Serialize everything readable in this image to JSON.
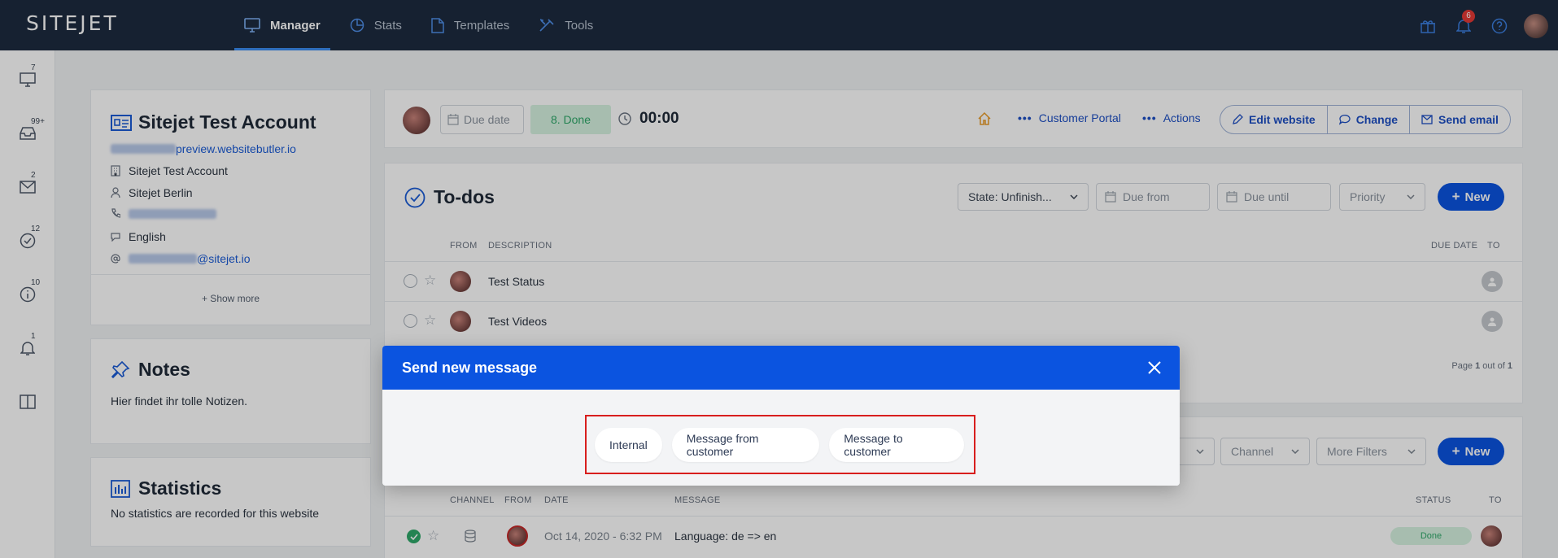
{
  "app": {
    "logo": "SITEJET"
  },
  "topnav": {
    "tabs": [
      {
        "label": "Manager",
        "icon": "monitor-icon",
        "active": true
      },
      {
        "label": "Stats",
        "icon": "pie-chart-icon"
      },
      {
        "label": "Templates",
        "icon": "document-icon"
      },
      {
        "label": "Tools",
        "icon": "tools-icon"
      }
    ],
    "notification_count": "6"
  },
  "rail": {
    "items": [
      {
        "icon": "monitor-icon",
        "count": "7"
      },
      {
        "icon": "inbox-icon",
        "count": "99+"
      },
      {
        "icon": "mail-icon",
        "count": "2"
      },
      {
        "icon": "check-icon",
        "count": "12"
      },
      {
        "icon": "info-icon",
        "count": "10"
      },
      {
        "icon": "bell-icon",
        "count": "1"
      },
      {
        "icon": "book-icon",
        "count": ""
      }
    ]
  },
  "account": {
    "title": "Sitejet Test Account",
    "url_suffix": "preview.websitebutler.io",
    "company": "Sitejet Test Account",
    "contact": "Sitejet Berlin",
    "language": "English",
    "email_suffix": "@sitejet.io",
    "show_more": "+ Show more"
  },
  "notes": {
    "title": "Notes",
    "text": "Hier findet ihr tolle Notizen."
  },
  "statistics": {
    "title": "Statistics",
    "text": "No statistics are recorded for this website"
  },
  "project_bar": {
    "due_date_placeholder": "Due date",
    "status": "8. Done",
    "timer": "00:00",
    "customer_portal": "Customer Portal",
    "actions": "Actions",
    "edit_website": "Edit website",
    "change": "Change",
    "send_email": "Send email"
  },
  "todos": {
    "title": "To-dos",
    "state_filter": "State: Unfinish...",
    "due_from": "Due from",
    "due_until": "Due until",
    "priority": "Priority",
    "new_label": "New",
    "columns": {
      "from": "FROM",
      "description": "DESCRIPTION",
      "due_date": "DUE DATE",
      "to": "TO"
    },
    "rows": [
      {
        "description": "Test Status"
      },
      {
        "description": "Test Videos"
      }
    ],
    "pagination": {
      "prefix": "Page ",
      "current": "1",
      "middle": " out of ",
      "total": "1"
    }
  },
  "messages": {
    "channel_filter": "Channel",
    "more_filters": "More Filters",
    "new_label": "New",
    "columns": {
      "channel": "CHANNEL",
      "from": "FROM",
      "date": "DATE",
      "message": "MESSAGE",
      "status": "STATUS",
      "to": "TO"
    },
    "rows": [
      {
        "date": "Oct 14, 2020 - 6:32 PM",
        "message": "Language: de => en",
        "status": "Done"
      }
    ]
  },
  "modal": {
    "title": "Send new message",
    "options": [
      "Internal",
      "Message from customer",
      "Message to customer"
    ]
  }
}
